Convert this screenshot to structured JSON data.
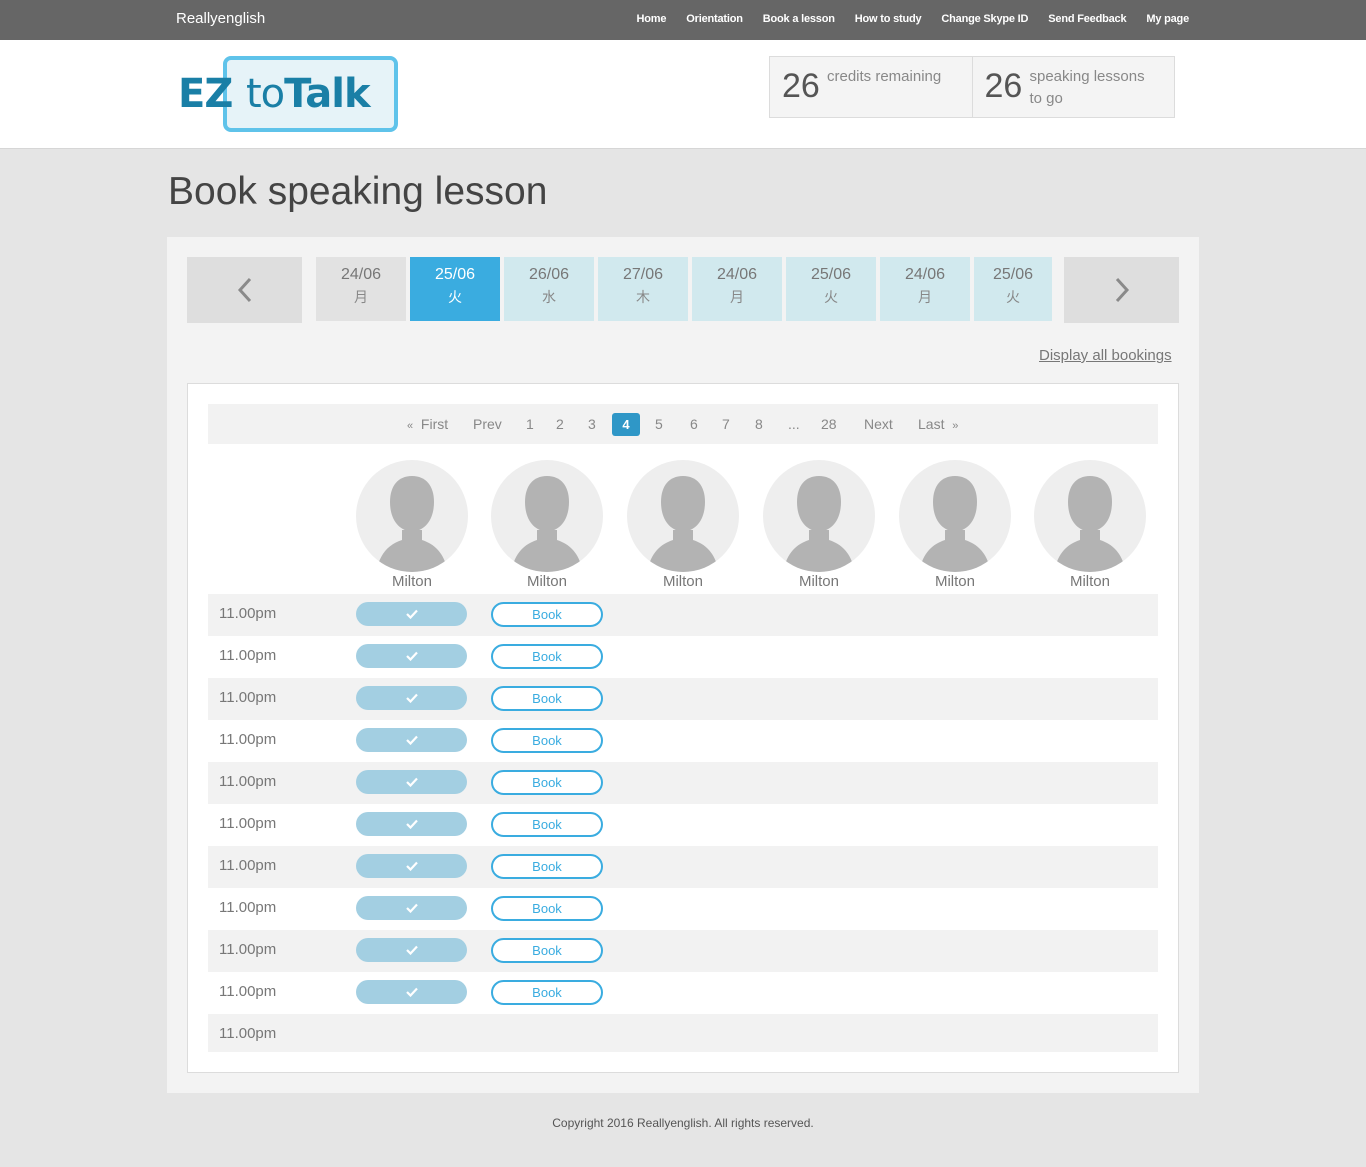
{
  "topbar": {
    "brand": "Reallyenglish",
    "nav": [
      "Home",
      "Orientation",
      "Book a lesson",
      "How to study",
      "Change Skype ID",
      "Send Feedback",
      "My page"
    ]
  },
  "logo": {
    "ez": "EZ",
    "to": "to",
    "talk": "Talk"
  },
  "stats": [
    {
      "num": "26",
      "label": "credits remaining"
    },
    {
      "num": "26",
      "label": "speaking lessons to go"
    }
  ],
  "page_title": "Book speaking lesson",
  "dates": [
    {
      "date": "24/06",
      "day": "月",
      "state": "past"
    },
    {
      "date": "25/06",
      "day": "火",
      "state": "active"
    },
    {
      "date": "26/06",
      "day": "水",
      "state": ""
    },
    {
      "date": "27/06",
      "day": "木",
      "state": ""
    },
    {
      "date": "24/06",
      "day": "月",
      "state": ""
    },
    {
      "date": "25/06",
      "day": "火",
      "state": ""
    },
    {
      "date": "24/06",
      "day": "月",
      "state": ""
    },
    {
      "date": "25/06",
      "day": "火",
      "state": ""
    }
  ],
  "display_all": "Display all bookings",
  "pagination": {
    "first": "First",
    "prev": "Prev",
    "pages": [
      "1",
      "2",
      "3",
      "4",
      "5",
      "6",
      "7",
      "8",
      "...",
      "28"
    ],
    "current": "4",
    "next": "Next",
    "last": "Last",
    "first_glyph": "«",
    "last_glyph": "»"
  },
  "tutors": [
    "Milton",
    "Milton",
    "Milton",
    "Milton",
    "Milton",
    "Milton"
  ],
  "slots": [
    {
      "time": "11.00pm",
      "booked": true,
      "book_label": "Book"
    },
    {
      "time": "11.00pm",
      "booked": true,
      "book_label": "Book"
    },
    {
      "time": "11.00pm",
      "booked": true,
      "book_label": "Book"
    },
    {
      "time": "11.00pm",
      "booked": true,
      "book_label": "Book"
    },
    {
      "time": "11.00pm",
      "booked": true,
      "book_label": "Book"
    },
    {
      "time": "11.00pm",
      "booked": true,
      "book_label": "Book"
    },
    {
      "time": "11.00pm",
      "booked": true,
      "book_label": "Book"
    },
    {
      "time": "11.00pm",
      "booked": true,
      "book_label": "Book"
    },
    {
      "time": "11.00pm",
      "booked": true,
      "book_label": "Book"
    },
    {
      "time": "11.00pm",
      "booked": true,
      "book_label": "Book"
    },
    {
      "time": "11.00pm",
      "booked": false,
      "book_label": ""
    }
  ],
  "footer": "Copyright 2016 Reallyenglish. All rights reserved.",
  "colors": {
    "accent": "#3aace0",
    "topbar": "#666666",
    "booked": "#a3cfe2"
  }
}
